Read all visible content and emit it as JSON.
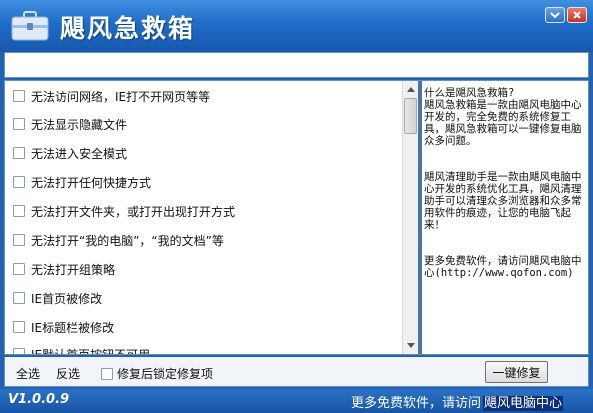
{
  "window": {
    "title": "飓风急救箱"
  },
  "repair_list": {
    "items": [
      {
        "label": "无法访问网络，IE打不开网页等等",
        "checked": false
      },
      {
        "label": "无法显示隐藏文件",
        "checked": false
      },
      {
        "label": "无法进入安全模式",
        "checked": false
      },
      {
        "label": "无法打开任何快捷方式",
        "checked": false
      },
      {
        "label": "无法打开文件夹，或打开出现打开方式",
        "checked": false
      },
      {
        "label": "无法打开“我的电脑”，“我的文档”等",
        "checked": false
      },
      {
        "label": "无法打开组策略",
        "checked": false
      },
      {
        "label": "IE首页被修改",
        "checked": false
      },
      {
        "label": "IE标题栏被修改",
        "checked": false
      },
      {
        "label": "IE默认首页按钮不可用",
        "checked": false
      }
    ]
  },
  "info": {
    "p1_title": "什么是飓风急救箱?",
    "p1_body": "飓风急救箱是一款由飓风电脑中心开发的，完全免费的系统修复工具，飓风急救箱可以一键修复电脑众多问题。",
    "p2_body": "飓风清理助手是一款由飓风电脑中心开发的系统优化工具，飓风清理助手可以清理众多浏览器和众多常用软件的痕迹，让您的电脑飞起来！",
    "p3_body": "更多免费软件，请访问飓风电脑中心(http://www.qofon.com)"
  },
  "actions": {
    "select_all": "全选",
    "invert": "反选",
    "lock_after_repair": "修复后锁定修复项",
    "lock_checked": false,
    "repair_button": "一键修复"
  },
  "status": {
    "version": "V1.0.0.9",
    "promo_text": "更多免费软件，请访问",
    "promo_link": "飓风电脑中心"
  },
  "colors": {
    "titlebar": "#1f6cc8",
    "statusbar": "#1654a4",
    "divider": "#4d74a8"
  }
}
